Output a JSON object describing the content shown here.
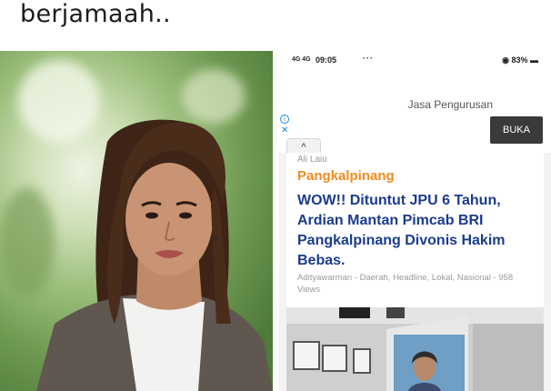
{
  "post": {
    "caption": "berjamaah.."
  },
  "photo": {
    "alt": "woman portrait"
  },
  "phone": {
    "status": {
      "signal": "4G 4G",
      "time": "09:05",
      "dots": "···",
      "battery": "83%"
    },
    "ad": {
      "text": "Jasa Pengurusan",
      "button_label": "BUKA"
    },
    "collapse_glyph": "^",
    "article": {
      "author_top": "Ali Laiu",
      "category": "Pangkalpinang",
      "headline": "WOW!! Dituntut JPU 6 Tahun, Ardian Mantan Pimcab BRI Pangkalpinang Divonis Hakim Bebas.",
      "meta": "Adityawarman - Daerah, Headline, Lokal, Nasional - 958 Views"
    }
  },
  "colors": {
    "category": "#f28b1d",
    "headline": "#1a3b8f",
    "button": "#3a3a3a"
  }
}
